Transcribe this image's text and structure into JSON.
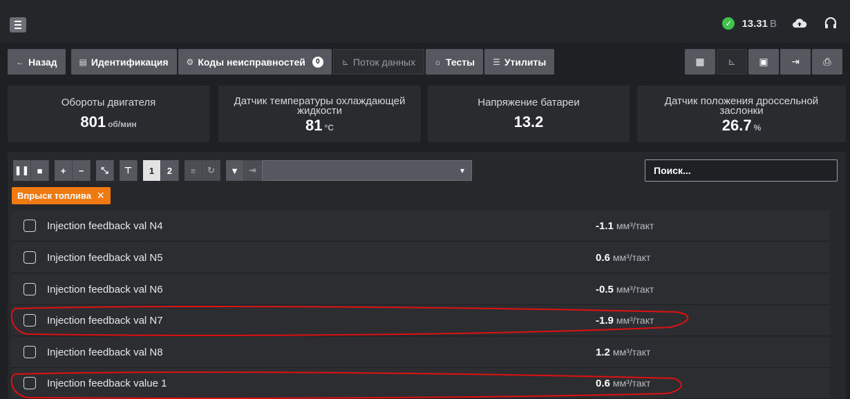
{
  "status": {
    "voltage": "13.31",
    "voltage_unit": "В"
  },
  "toolbar": {
    "back": "Назад",
    "identification": "Идентификация",
    "dtc": "Коды неисправностей",
    "dtc_count": "0",
    "data_stream": "Поток данных",
    "tests": "Тесты",
    "utilities": "Утилиты"
  },
  "cards": [
    {
      "title": "Обороты двигателя",
      "value": "801",
      "unit": "об/мин"
    },
    {
      "title": "Датчик температуры охлаждающей жидкости",
      "value": "81",
      "unit": "°C"
    },
    {
      "title": "Напряжение батареи",
      "value": "13.2",
      "unit": ""
    },
    {
      "title": "Датчик положения дроссельной заслонки",
      "value": "26.7",
      "unit": "%"
    }
  ],
  "controls": {
    "page1": "1",
    "page2": "2"
  },
  "search": {
    "placeholder": "Поиск..."
  },
  "filter_tag": "Впрыск топлива",
  "rows": [
    {
      "label": "Injection feedback val N4",
      "value": "-1.1",
      "unit": "мм³/такт"
    },
    {
      "label": "Injection feedback val N5",
      "value": "0.6",
      "unit": "мм³/такт"
    },
    {
      "label": "Injection feedback val N6",
      "value": "-0.5",
      "unit": "мм³/такт"
    },
    {
      "label": "Injection feedback val N7",
      "value": "-1.9",
      "unit": "мм³/такт"
    },
    {
      "label": "Injection feedback val N8",
      "value": "1.2",
      "unit": "мм³/такт"
    },
    {
      "label": "Injection feedback value 1",
      "value": "0.6",
      "unit": "мм³/такт"
    }
  ]
}
